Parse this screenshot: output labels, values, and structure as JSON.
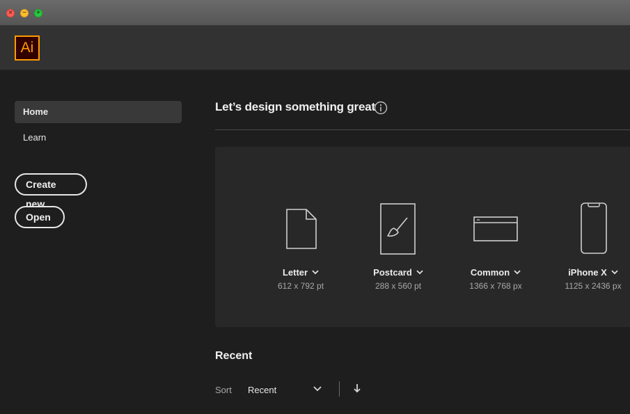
{
  "window": {
    "controls": [
      "close",
      "minimize",
      "zoom"
    ]
  },
  "app": {
    "logo_text": "Ai",
    "accent_color": "#ff9a00"
  },
  "sidebar": {
    "items": [
      {
        "label": "Home",
        "selected": true
      },
      {
        "label": "Learn",
        "selected": false
      }
    ],
    "create_new_label": "Create new",
    "open_label": "Open"
  },
  "main": {
    "heading": "Let’s design something great",
    "info_icon": "info-icon",
    "presets": [
      {
        "name": "Letter",
        "size": "612 x 792 pt",
        "icon": "document-icon"
      },
      {
        "name": "Postcard",
        "size": "288 x 560 pt",
        "icon": "brush-card-icon"
      },
      {
        "name": "Common",
        "size": "1366 x 768 px",
        "icon": "browser-window-icon"
      },
      {
        "name": "iPhone X",
        "size": "1125 x 2436 px",
        "icon": "phone-icon"
      }
    ],
    "recent": {
      "title": "Recent",
      "sort_label": "Sort",
      "sort_value": "Recent",
      "sort_direction_icon": "arrow-down-icon"
    }
  }
}
